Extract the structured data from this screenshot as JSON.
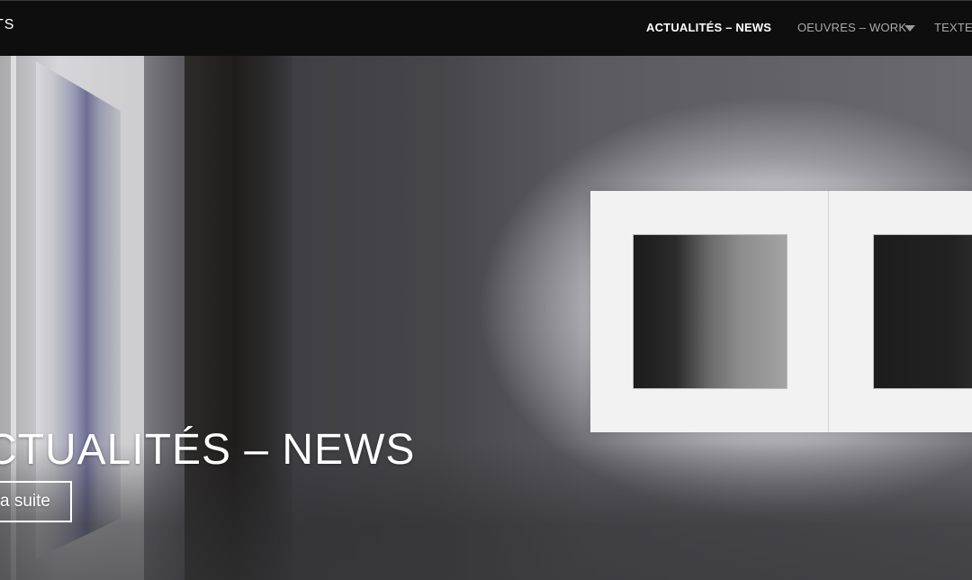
{
  "header": {
    "logo_text": "TS",
    "nav": {
      "news": "ACTUALITÉS – NEWS",
      "work": "OEUVRES – WORK",
      "textes": "TEXTES"
    },
    "dropdown_icon": "caret-down-icon"
  },
  "hero": {
    "title": "CTUALITÉS – NEWS",
    "button_label": "a suite"
  },
  "colors": {
    "topbar": "#0e0e0e",
    "nav_active": "#ffffff",
    "nav_inactive": "#a9a9a9"
  }
}
